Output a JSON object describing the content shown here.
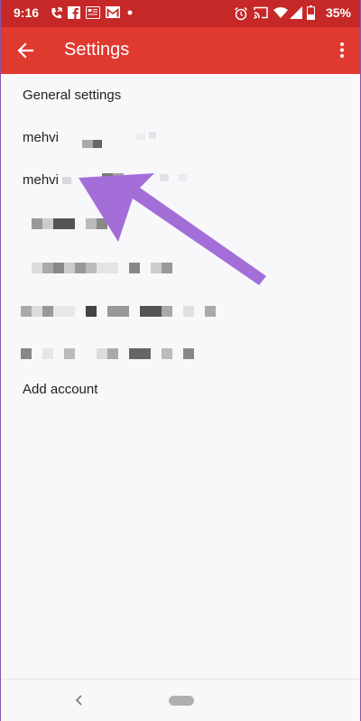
{
  "status_bar": {
    "time": "9:16",
    "battery": "35%",
    "left_icons": [
      "missed-call-icon",
      "facebook-icon",
      "news-icon",
      "gmail-icon",
      "dot-icon"
    ],
    "right_icons": [
      "alarm-icon",
      "cast-icon",
      "wifi-icon",
      "signal-icon",
      "battery-icon"
    ]
  },
  "app_bar": {
    "title": "Settings",
    "color": "#e0392f"
  },
  "settings_list": {
    "general": "General settings",
    "account1_name": "mehvi",
    "account2_name": "mehvi",
    "add_account": "Add account"
  },
  "annotation": {
    "arrow_color": "#a46ed9"
  }
}
